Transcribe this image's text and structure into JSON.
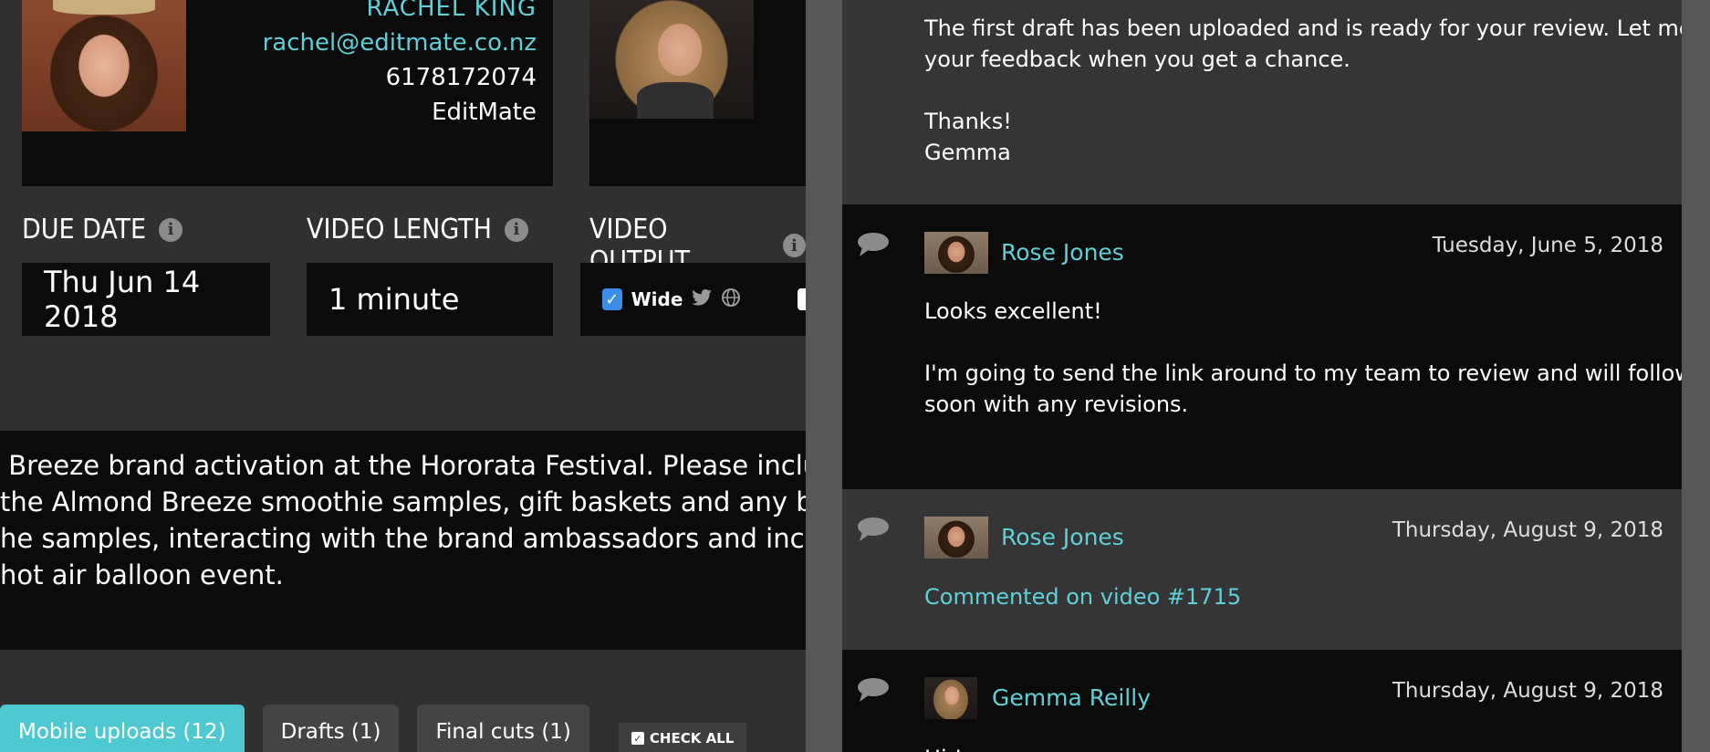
{
  "contact": {
    "name": "RACHEL KING",
    "email": "rachel@editmate.co.nz",
    "phone": "6178172074",
    "company": "EditMate"
  },
  "fields": {
    "due_date_label": "DUE DATE",
    "due_date_value": "Thu Jun 14 2018",
    "video_length_label": "VIDEO LENGTH",
    "video_length_value": "1 minute",
    "video_output_label": "VIDEO OUTPUT",
    "output_wide_label": "Wide"
  },
  "description": " Breeze brand activation at the Hororata Festival. Please include Almo\nthe Almond Breeze smoothie samples, gift baskets and any branding c\nhe samples, interacting with the brand ambassadors and include lots\nhot air balloon event.",
  "tabs": [
    {
      "label": "Mobile uploads (12)",
      "active": true
    },
    {
      "label": "Drafts (1)",
      "active": false
    },
    {
      "label": "Final cuts (1)",
      "active": false
    }
  ],
  "check_all_label": "CHECK ALL",
  "messages": [
    {
      "text": "The first draft has been uploaded and is ready for your review. Let me know\nyour feedback when you get a chance.\n\nThanks!\nGemma"
    },
    {
      "author": "Rose Jones",
      "date": "Tuesday, June 5, 2018",
      "text": "Looks excellent!\n\nI'm going to send the link around to my team to review and will follow up again\nsoon with any revisions."
    },
    {
      "author": "Rose Jones",
      "date": "Thursday, August 9, 2018",
      "link": "Commented on video #1715"
    },
    {
      "author": "Gemma Reilly",
      "date": "Thursday, August 9, 2018",
      "text": "Hi !"
    }
  ],
  "colors": {
    "accent": "#5fd0d8",
    "active_tab": "#4fc9d1",
    "panel_dark": "#0b0b0b",
    "panel_grey": "#303030",
    "checkbox_blue": "#3b8de6"
  }
}
